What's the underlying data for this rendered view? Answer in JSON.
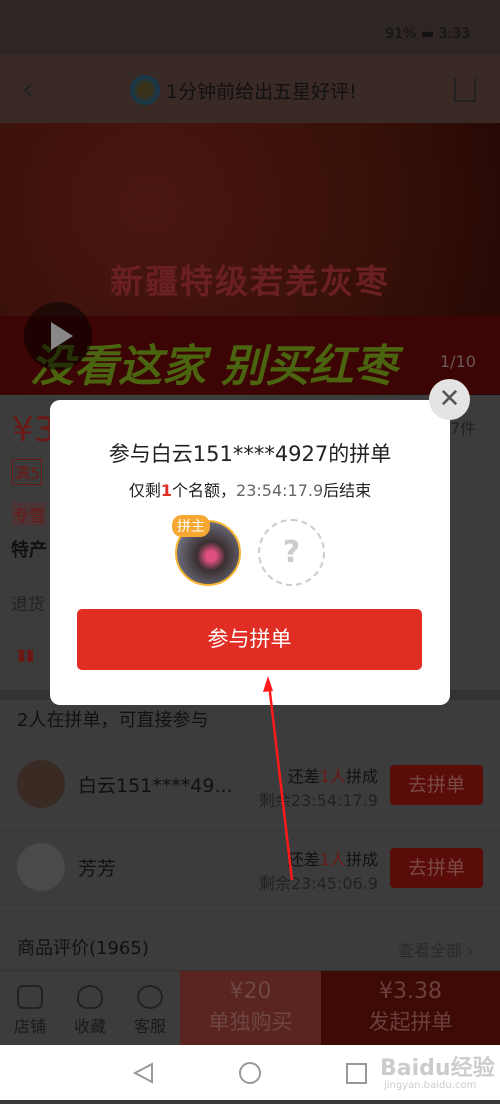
{
  "status_bar": {
    "battery": "91%",
    "time": "3:33"
  },
  "header": {
    "title": "1分钟前给出五星好评!"
  },
  "banner": {
    "line1": "新疆特级若羌灰枣",
    "line2": "没看这家 别买红枣",
    "pager": "1/10"
  },
  "product": {
    "price_prefix": "¥3",
    "sold": "7件",
    "tag1": "满5",
    "tag2": "专营",
    "tag3": "特产",
    "returns": "退货"
  },
  "group_section": {
    "title": "2人在拼单，可直接参与",
    "groups": [
      {
        "name": "白云151****49...",
        "need_pre": "还差",
        "need": "1人",
        "need_post": "拼成",
        "remain": "剩余23:54:17.9",
        "button": "去拼单"
      },
      {
        "name": "芳芳",
        "need_pre": "还差",
        "need": "1人",
        "need_post": "拼成",
        "remain": "剩余23:45:06.9",
        "button": "去拼单"
      }
    ]
  },
  "reviews": {
    "title": "商品评价(1965)",
    "view_all": "查看全部"
  },
  "bottom_bar": {
    "shop": "店铺",
    "favorite": "收藏",
    "service": "客服",
    "solo_price": "¥20",
    "solo_label": "单独购买",
    "group_price": "¥3.38",
    "group_label": "发起拼单"
  },
  "modal": {
    "title": "参与白云151****4927的拼单",
    "sub_pre": "仅剩",
    "sub_count": "1",
    "sub_mid": "个名额，",
    "sub_time": "23:54:17.9",
    "sub_post": "后结束",
    "host_tag": "拼主",
    "empty_slot": "?",
    "join_button": "参与拼单"
  },
  "watermark": {
    "text": "Baidu经验",
    "url": "jingyan.baidu.com"
  },
  "colors": {
    "accent": "#e02e24",
    "host_tag": "#f7a833"
  }
}
